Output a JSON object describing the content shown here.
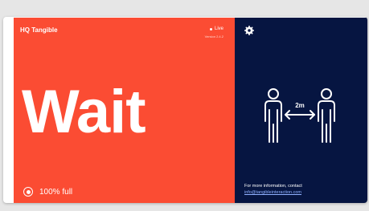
{
  "app": {
    "brand": "HQ Tangible",
    "status": "Live",
    "version": "Version 2.4.2"
  },
  "main": {
    "headline": "Wait",
    "capacity": "100% full"
  },
  "aside": {
    "distance_label": "2m",
    "info_text": "For more information, contact",
    "info_link": "info@tangibleinteraction.com"
  },
  "icons": {
    "settings": "gear-icon",
    "capacity": "target-icon",
    "people": "social-distancing-icon"
  },
  "colors": {
    "status_panel": "#fb4c33",
    "info_panel": "#061541",
    "text": "#ffffff"
  }
}
